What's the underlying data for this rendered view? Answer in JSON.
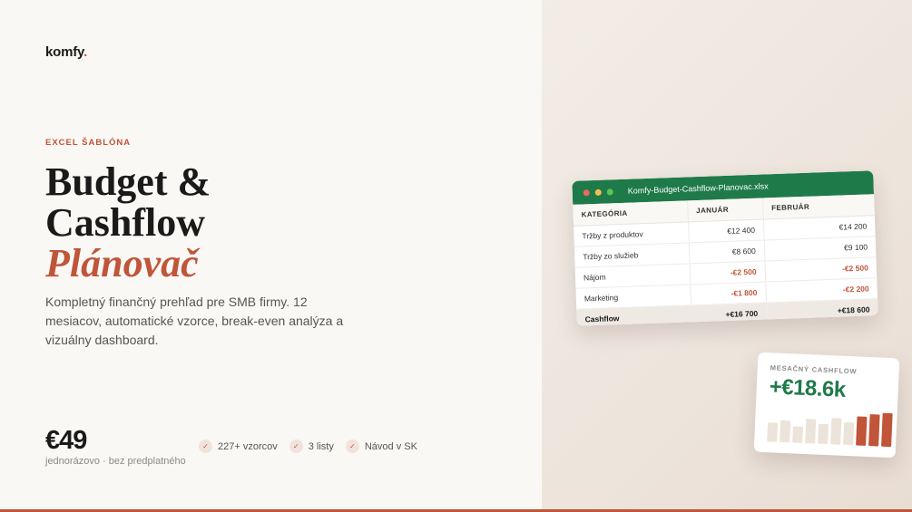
{
  "brand": {
    "name": "komfy",
    "dot": "."
  },
  "hero": {
    "eyebrow": "EXCEL ŠABLÓNA",
    "title_line1": "Budget &",
    "title_line2": "Cashflow",
    "title_accent": "Plánovač",
    "description": "Kompletný finančný prehľad pre SMB firmy. 12 mesiacov, automatické vzorce, break-even analýza a vizuálny dashboard."
  },
  "pricing": {
    "price": "€49",
    "note": "jednorázovo · bez predplatného"
  },
  "features": [
    {
      "icon": "check-icon",
      "label": "227+ vzorcov"
    },
    {
      "icon": "check-icon",
      "label": "3 listy"
    },
    {
      "icon": "check-icon",
      "label": "Návod v SK"
    }
  ],
  "spreadsheet": {
    "filename": "Komfy-Budget-Cashflow-Planovac.xlsx",
    "headers": [
      "KATEGÓRIA",
      "JANUÁR",
      "FEBRUÁR"
    ],
    "rows": [
      {
        "category": "Tržby z produktov",
        "jan": "€12 400",
        "feb": "€14 200"
      },
      {
        "category": "Tržby zo služieb",
        "jan": "€8 600",
        "feb": "€9 100"
      },
      {
        "category": "Nájom",
        "jan": "-€2 500",
        "feb": "-€2 500"
      },
      {
        "category": "Marketing",
        "jan": "-€1 800",
        "feb": "-€2 200"
      }
    ],
    "total": {
      "category": "Cashflow",
      "jan": "+€16 700",
      "feb": "+€18 600"
    }
  },
  "cashflow_card": {
    "label": "MESAČNÝ CASHFLOW",
    "value": "+€18.6k",
    "bars": [
      {
        "value": 0.55,
        "highlight": false
      },
      {
        "value": 0.62,
        "highlight": false
      },
      {
        "value": 0.48,
        "highlight": false
      },
      {
        "value": 0.7,
        "highlight": false
      },
      {
        "value": 0.58,
        "highlight": false
      },
      {
        "value": 0.75,
        "highlight": false
      },
      {
        "value": 0.66,
        "highlight": false
      },
      {
        "value": 0.85,
        "highlight": true
      },
      {
        "value": 0.92,
        "highlight": true
      },
      {
        "value": 0.97,
        "highlight": true
      }
    ]
  },
  "colors": {
    "accent": "#c0553a",
    "excel_green": "#1f7a4a",
    "bar_muted": "#ece3da"
  }
}
